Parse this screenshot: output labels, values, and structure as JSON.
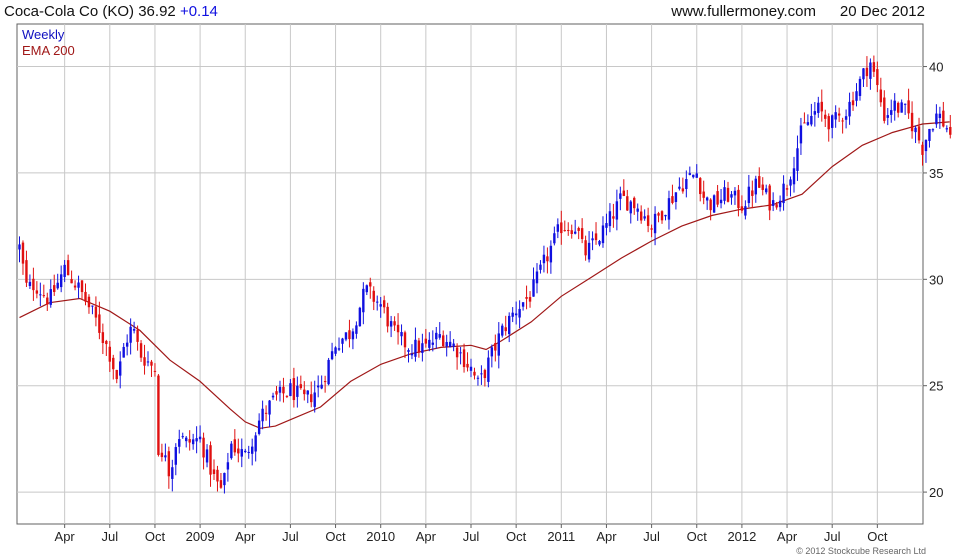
{
  "header": {
    "symbol": "Coca-Cola Co (KO)",
    "price": "36.92",
    "change": "+0.14",
    "website": "www.fullermoney.com",
    "date": "20 Dec 2012"
  },
  "legend": {
    "period": "Weekly",
    "ema": "EMA 200"
  },
  "copyright": "© 2012 Stockcube Research Ltd",
  "colors": {
    "up": "#1010e0",
    "down": "#e01010",
    "ema": "#a01818",
    "grid": "#c8c8c8",
    "frame": "#606060"
  },
  "chart_data": {
    "type": "candlestick",
    "title": "Coca-Cola Co (KO) 36.92 +0.14",
    "period": "Weekly",
    "ylim": [
      18.5,
      42
    ],
    "yticks": [
      20,
      25,
      30,
      35,
      40
    ],
    "xticks": [
      "Apr",
      "Jul",
      "Oct",
      "2009",
      "Apr",
      "Jul",
      "Oct",
      "2010",
      "Apr",
      "Jul",
      "Oct",
      "2011",
      "Apr",
      "Jul",
      "Oct",
      "2012",
      "Apr",
      "Jul",
      "Oct"
    ],
    "x_range": [
      "2008-01",
      "2012-12"
    ],
    "close_points": [
      {
        "m": 0,
        "v": 31.5
      },
      {
        "m": 0.5,
        "v": 29.5
      },
      {
        "m": 1,
        "v": 29.8
      },
      {
        "m": 2,
        "v": 29.0
      },
      {
        "m": 3,
        "v": 30.5
      },
      {
        "m": 3.5,
        "v": 30.0
      },
      {
        "m": 4,
        "v": 29.5
      },
      {
        "m": 5,
        "v": 28.2
      },
      {
        "m": 6,
        "v": 26.5
      },
      {
        "m": 6.5,
        "v": 25.3
      },
      {
        "m": 7,
        "v": 27.0
      },
      {
        "m": 7.5,
        "v": 27.8
      },
      {
        "m": 8,
        "v": 26.5
      },
      {
        "m": 9,
        "v": 25.8
      },
      {
        "m": 9.3,
        "v": 21.0
      },
      {
        "m": 9.7,
        "v": 22.0
      },
      {
        "m": 10,
        "v": 20.8
      },
      {
        "m": 10.5,
        "v": 22.8
      },
      {
        "m": 11,
        "v": 22.3
      },
      {
        "m": 12,
        "v": 22.5
      },
      {
        "m": 13,
        "v": 20.5
      },
      {
        "m": 13.5,
        "v": 20.0
      },
      {
        "m": 14,
        "v": 22.3
      },
      {
        "m": 15,
        "v": 21.7
      },
      {
        "m": 16,
        "v": 23.5
      },
      {
        "m": 17,
        "v": 24.4
      },
      {
        "m": 18,
        "v": 24.8
      },
      {
        "m": 19,
        "v": 24.3
      },
      {
        "m": 20,
        "v": 25.0
      },
      {
        "m": 21,
        "v": 27.0
      },
      {
        "m": 22,
        "v": 27.5
      },
      {
        "m": 23,
        "v": 29.5
      },
      {
        "m": 24,
        "v": 28.8
      },
      {
        "m": 25,
        "v": 27.3
      },
      {
        "m": 26,
        "v": 26.8
      },
      {
        "m": 27,
        "v": 26.8
      },
      {
        "m": 28,
        "v": 27.4
      },
      {
        "m": 29,
        "v": 26.8
      },
      {
        "m": 30,
        "v": 25.8
      },
      {
        "m": 30.5,
        "v": 25.0
      },
      {
        "m": 31,
        "v": 25.8
      },
      {
        "m": 32,
        "v": 27.5
      },
      {
        "m": 33,
        "v": 28.6
      },
      {
        "m": 34,
        "v": 29.3
      },
      {
        "m": 35,
        "v": 31.0
      },
      {
        "m": 36,
        "v": 32.5
      },
      {
        "m": 37,
        "v": 32.5
      },
      {
        "m": 37.5,
        "v": 31.2
      },
      {
        "m": 38,
        "v": 31.5
      },
      {
        "m": 39,
        "v": 32.5
      },
      {
        "m": 40,
        "v": 33.8
      },
      {
        "m": 41,
        "v": 33.5
      },
      {
        "m": 42,
        "v": 32.5
      },
      {
        "m": 43,
        "v": 33.5
      },
      {
        "m": 44,
        "v": 34.5
      },
      {
        "m": 45,
        "v": 35.0
      },
      {
        "m": 45.5,
        "v": 33.8
      },
      {
        "m": 46,
        "v": 33.5
      },
      {
        "m": 47,
        "v": 34.0
      },
      {
        "m": 48,
        "v": 33.5
      },
      {
        "m": 49,
        "v": 34.5
      },
      {
        "m": 50,
        "v": 33.5
      },
      {
        "m": 51,
        "v": 34.5
      },
      {
        "m": 52,
        "v": 37.0
      },
      {
        "m": 53,
        "v": 38.0
      },
      {
        "m": 54,
        "v": 37.3
      },
      {
        "m": 55,
        "v": 38.0
      },
      {
        "m": 56,
        "v": 39.5
      },
      {
        "m": 56.5,
        "v": 40.3
      },
      {
        "m": 57,
        "v": 39.0
      },
      {
        "m": 57.5,
        "v": 37.6
      },
      {
        "m": 58,
        "v": 38.2
      },
      {
        "m": 59,
        "v": 37.8
      },
      {
        "m": 59.5,
        "v": 37.0
      },
      {
        "m": 60,
        "v": 36.2
      },
      {
        "m": 60.5,
        "v": 37.2
      },
      {
        "m": 61,
        "v": 37.8
      },
      {
        "m": 61.8,
        "v": 36.92
      }
    ],
    "ema_points": [
      {
        "m": 0,
        "v": 28.2
      },
      {
        "m": 2,
        "v": 28.9
      },
      {
        "m": 4,
        "v": 29.1
      },
      {
        "m": 6,
        "v": 28.5
      },
      {
        "m": 8,
        "v": 27.6
      },
      {
        "m": 10,
        "v": 26.2
      },
      {
        "m": 12,
        "v": 25.2
      },
      {
        "m": 14,
        "v": 23.9
      },
      {
        "m": 15,
        "v": 23.3
      },
      {
        "m": 16,
        "v": 23.0
      },
      {
        "m": 17,
        "v": 23.1
      },
      {
        "m": 18,
        "v": 23.4
      },
      {
        "m": 20,
        "v": 24.0
      },
      {
        "m": 22,
        "v": 25.2
      },
      {
        "m": 24,
        "v": 26.0
      },
      {
        "m": 26,
        "v": 26.5
      },
      {
        "m": 28,
        "v": 26.8
      },
      {
        "m": 30,
        "v": 26.9
      },
      {
        "m": 31,
        "v": 26.7
      },
      {
        "m": 32,
        "v": 27.1
      },
      {
        "m": 34,
        "v": 28.0
      },
      {
        "m": 36,
        "v": 29.2
      },
      {
        "m": 38,
        "v": 30.1
      },
      {
        "m": 40,
        "v": 31.0
      },
      {
        "m": 42,
        "v": 31.8
      },
      {
        "m": 44,
        "v": 32.5
      },
      {
        "m": 46,
        "v": 33.0
      },
      {
        "m": 48,
        "v": 33.3
      },
      {
        "m": 50,
        "v": 33.5
      },
      {
        "m": 52,
        "v": 34.0
      },
      {
        "m": 54,
        "v": 35.3
      },
      {
        "m": 56,
        "v": 36.3
      },
      {
        "m": 58,
        "v": 36.9
      },
      {
        "m": 60,
        "v": 37.3
      },
      {
        "m": 61.8,
        "v": 37.4
      }
    ]
  }
}
